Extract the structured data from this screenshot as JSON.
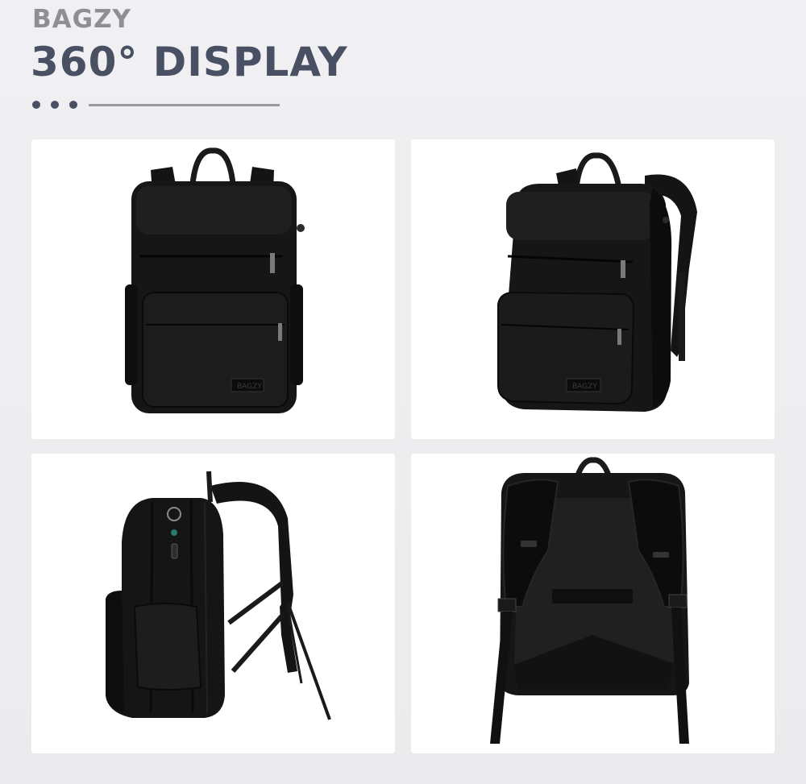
{
  "header": {
    "brand": "BAGZY",
    "headline": "360° DISPLAY"
  },
  "gallery": {
    "views": [
      {
        "view": "front",
        "patch_text": "BAGZY"
      },
      {
        "view": "front-angled",
        "patch_text": "BAGZY"
      },
      {
        "view": "side"
      },
      {
        "view": "back"
      }
    ]
  },
  "colors": {
    "headline": "#495064",
    "brand": "#8e8f94",
    "bag": "#141414",
    "card": "#ffffff",
    "background": "#eeeef0"
  }
}
